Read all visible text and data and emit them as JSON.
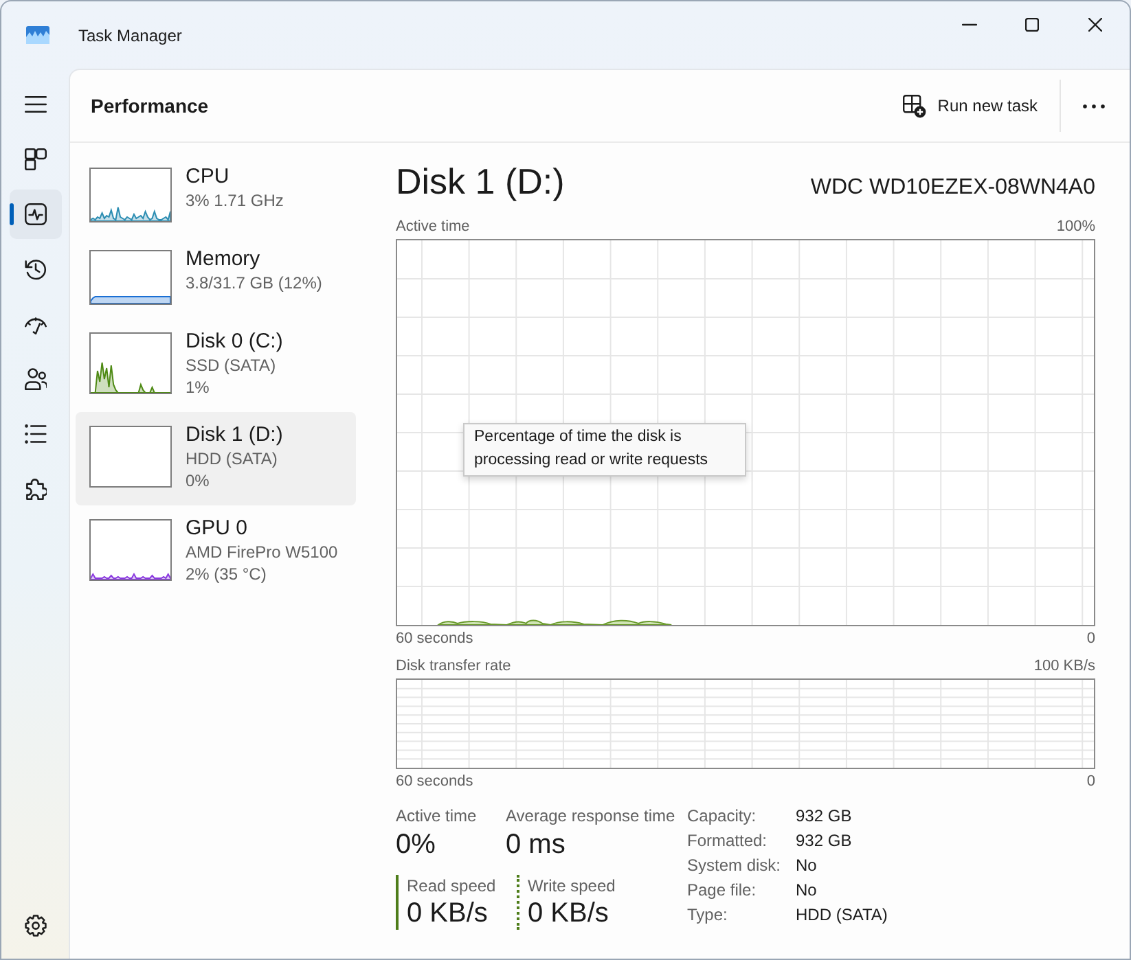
{
  "window": {
    "title": "Task Manager"
  },
  "nav": {
    "items": [
      {
        "kind": "processes",
        "selected": false
      },
      {
        "kind": "performance",
        "selected": true
      },
      {
        "kind": "history",
        "selected": false
      },
      {
        "kind": "startup",
        "selected": false
      },
      {
        "kind": "users",
        "selected": false
      },
      {
        "kind": "details",
        "selected": false
      },
      {
        "kind": "services",
        "selected": false
      }
    ],
    "bottom_items": [
      {
        "kind": "settings",
        "selected": false
      }
    ]
  },
  "header": {
    "title": "Performance",
    "run_task_button": "Run new task"
  },
  "devices": [
    {
      "kind": "cpu",
      "name": "CPU",
      "details": [
        "3% 1.71 GHz"
      ],
      "color": "#2b8db2",
      "selected": false
    },
    {
      "kind": "memory",
      "name": "Memory",
      "details": [
        "3.8/31.7 GB (12%)"
      ],
      "color": "#1a6fd4",
      "selected": false
    },
    {
      "kind": "disk",
      "name": "Disk 0 (C:)",
      "details": [
        "SSD (SATA)",
        "1%"
      ],
      "color": "#4e8a14",
      "selected": false
    },
    {
      "kind": "disk",
      "name": "Disk 1 (D:)",
      "details": [
        "HDD (SATA)",
        "0%"
      ],
      "selected": true
    },
    {
      "kind": "gpu",
      "name": "GPU 0",
      "details": [
        "AMD FirePro W5100",
        "2% (35 °C)"
      ],
      "color": "#8a38e0",
      "selected": false
    }
  ],
  "detail": {
    "title": "Disk 1 (D:)",
    "model": "WDC WD10EZEX-08WN4A0",
    "charts": [
      {
        "kind": "active_time",
        "label": "Active time",
        "max_label": "100%",
        "start_label": "60 seconds",
        "end_label": "0",
        "tooltip": "Percentage of time the disk is processing read or write requests"
      },
      {
        "kind": "transfer_rate",
        "label": "Disk transfer rate",
        "max_label": "100 KB/s",
        "start_label": "60 seconds",
        "end_label": "0"
      }
    ],
    "stats": [
      {
        "label": "Active time",
        "value": "0%"
      },
      {
        "label": "Average response time",
        "value": "0 ms"
      }
    ],
    "speeds": [
      {
        "kind": "read",
        "label": "Read speed",
        "value": "0 KB/s"
      },
      {
        "kind": "write",
        "label": "Write speed",
        "value": "0 KB/s"
      }
    ],
    "properties": [
      {
        "label": "Capacity:",
        "value": "932 GB"
      },
      {
        "label": "Formatted:",
        "value": "932 GB"
      },
      {
        "label": "System disk:",
        "value": "No"
      },
      {
        "label": "Page file:",
        "value": "No"
      },
      {
        "label": "Type:",
        "value": "HDD (SATA)"
      }
    ]
  }
}
